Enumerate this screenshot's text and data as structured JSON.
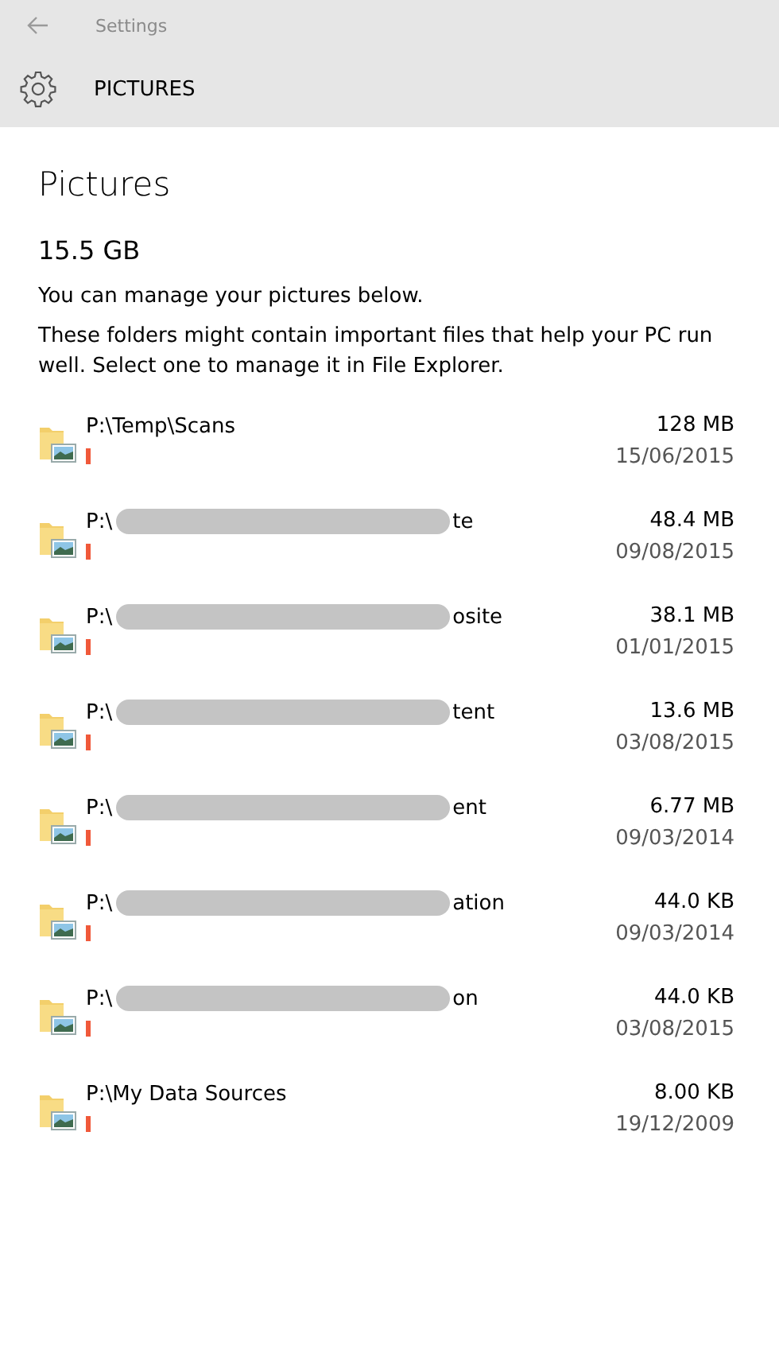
{
  "title_bar": {
    "title": "Settings"
  },
  "header": {
    "title": "PICTURES"
  },
  "page": {
    "heading": "Pictures",
    "total": "15.5 GB",
    "intro": "You can manage your pictures below.",
    "description": "These folders might contain important files that help your PC run well. Select one to manage it in File Explorer."
  },
  "folders": [
    {
      "redacted": false,
      "path": "P:\\Temp\\Scans",
      "size": "128 MB",
      "date": "15/06/2015"
    },
    {
      "redacted": true,
      "path_start": "P:\\",
      "path_end": "te",
      "size": "48.4 MB",
      "date": "09/08/2015"
    },
    {
      "redacted": true,
      "path_start": "P:\\",
      "path_end": "osite",
      "size": "38.1 MB",
      "date": "01/01/2015"
    },
    {
      "redacted": true,
      "path_start": "P:\\",
      "path_end": "tent",
      "size": "13.6 MB",
      "date": "03/08/2015"
    },
    {
      "redacted": true,
      "path_start": "P:\\",
      "path_end": "ent",
      "size": "6.77 MB",
      "date": "09/03/2014"
    },
    {
      "redacted": true,
      "path_start": "P:\\",
      "path_end": "ation",
      "size": "44.0 KB",
      "date": "09/03/2014"
    },
    {
      "redacted": true,
      "path_start": "P:\\",
      "path_end": "on",
      "size": "44.0 KB",
      "date": "03/08/2015"
    },
    {
      "redacted": false,
      "path": "P:\\My Data Sources",
      "size": "8.00 KB",
      "date": "19/12/2009"
    }
  ]
}
